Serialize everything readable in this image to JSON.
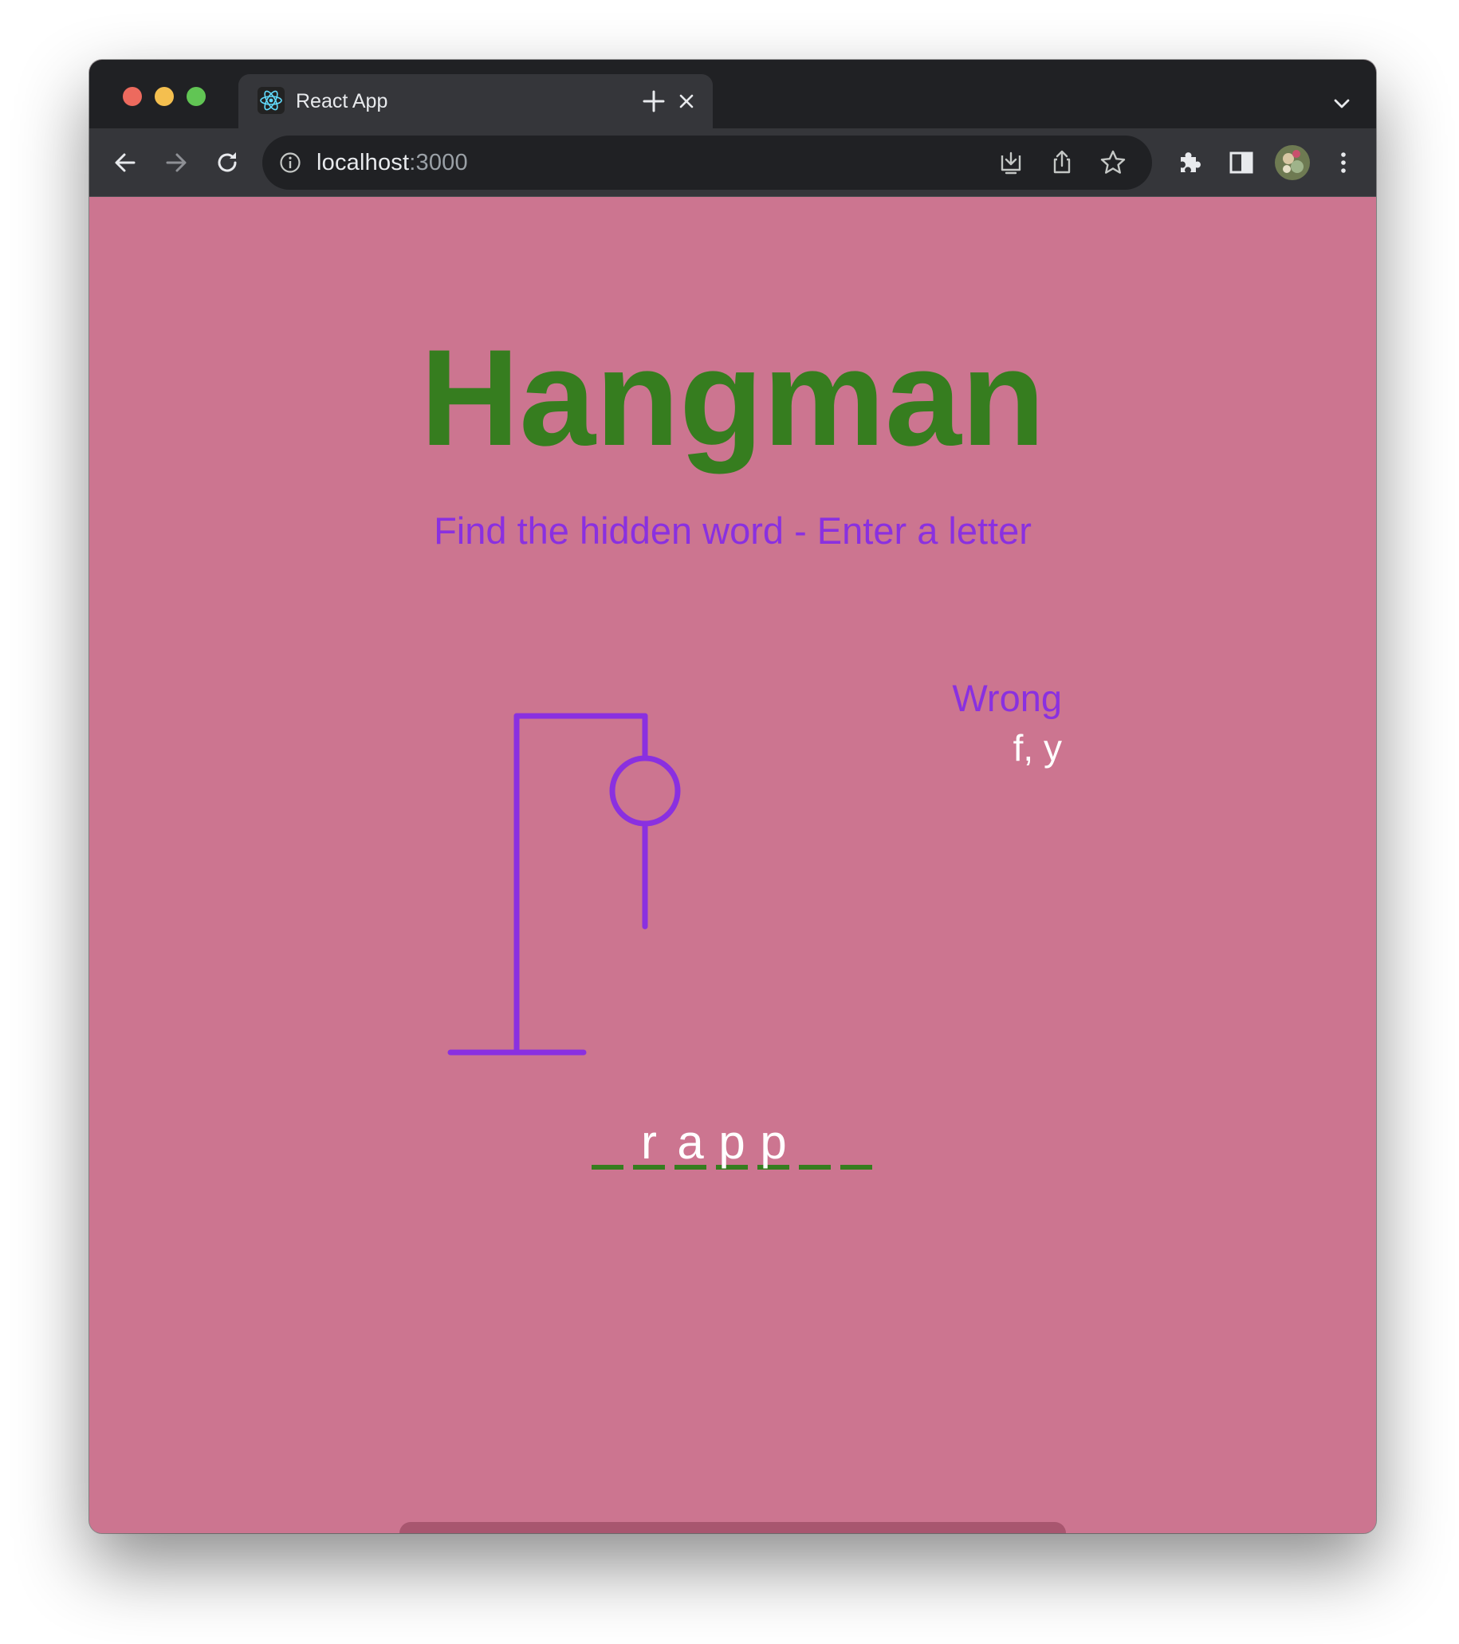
{
  "browser": {
    "tab_title": "React App",
    "url_host": "localhost",
    "url_port": ":3000",
    "icons": [
      "react-favicon-icon",
      "close-icon",
      "plus-icon",
      "chevron-down-icon",
      "back-arrow-icon",
      "forward-arrow-icon",
      "reload-icon",
      "info-icon",
      "install-icon",
      "share-icon",
      "star-icon",
      "puzzle-icon",
      "side-panel-icon",
      "avatar",
      "kebab-menu-icon"
    ]
  },
  "game": {
    "title": "Hangman",
    "subtitle": "Find the hidden word - Enter a letter",
    "wrong_label": "Wrong",
    "wrong_letters": "f, y",
    "word_slots": [
      "",
      "r",
      "a",
      "p",
      "p",
      "",
      ""
    ],
    "colors": {
      "background": "#cc7590",
      "title": "#367d1f",
      "accent": "#8a30e0",
      "letter": "#ffffff",
      "underline": "#367d1f"
    }
  }
}
